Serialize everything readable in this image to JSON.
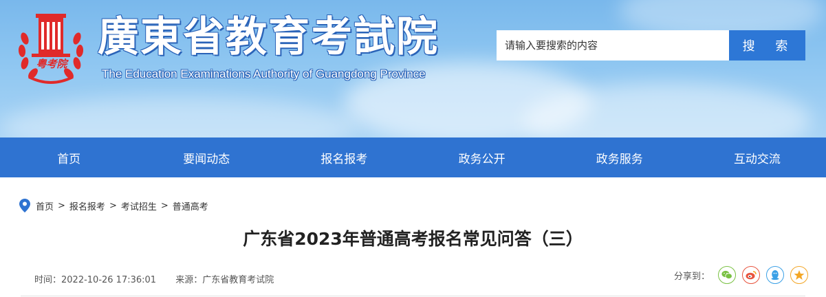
{
  "header": {
    "logo_text": "粤考院",
    "title_cn": "廣東省教育考試院",
    "title_en": "The Education Examinations Authority of Guangdong Province",
    "search_placeholder": "请输入要搜索的内容",
    "search_button": "搜 索",
    "colors": {
      "sky": "#8ec6f1",
      "accent": "#2d77d6",
      "emblem": "#e02a2a"
    }
  },
  "nav": {
    "items": [
      {
        "label": "首页"
      },
      {
        "label": "要闻动态"
      },
      {
        "label": "报名报考"
      },
      {
        "label": "政务公开"
      },
      {
        "label": "政务服务"
      },
      {
        "label": "互动交流"
      }
    ],
    "color": "#2f73d1"
  },
  "breadcrumb": {
    "icon": "location-pin-icon",
    "items": [
      {
        "label": "首页"
      },
      {
        "label": "报名报考"
      },
      {
        "label": "考试招生"
      },
      {
        "label": "普通高考"
      }
    ],
    "separator": ">"
  },
  "article": {
    "title": "广东省2023年普通高考报名常见问答（三）",
    "time": "时间：2022-10-26 17:36:01",
    "source": "来源：广东省教育考试院"
  },
  "share": {
    "label": "分享到：",
    "icons": [
      "wechat-icon",
      "weibo-icon",
      "qq-icon",
      "qzone-star-icon"
    ]
  }
}
